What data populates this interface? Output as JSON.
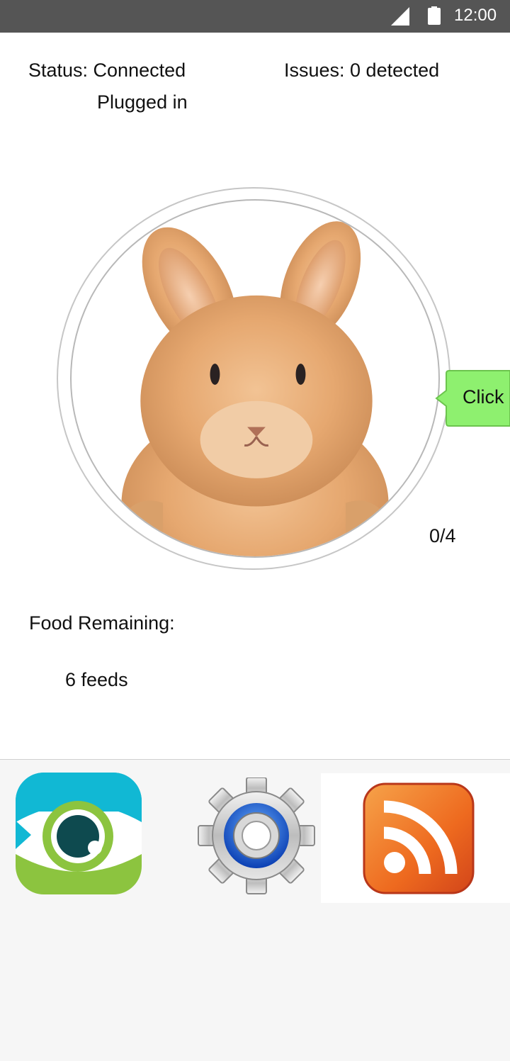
{
  "status_bar": {
    "time": "12:00",
    "signal_icon": "signal-icon",
    "battery_icon": "battery-icon"
  },
  "device": {
    "status": "Status: Connected",
    "power": "Plugged in",
    "issues": "Issues: 0 detected"
  },
  "pet": {
    "image_icon": "rabbit-photo",
    "callout_label": "Click",
    "counter": "0/4"
  },
  "food": {
    "label": "Food Remaining:",
    "value": "6 feeds"
  },
  "bottom_nav": {
    "items": [
      {
        "icon": "eye-icon",
        "selected": false
      },
      {
        "icon": "gear-icon",
        "selected": false
      },
      {
        "icon": "rss-icon",
        "selected": true
      }
    ]
  },
  "colors": {
    "status_bar": "#555555",
    "callout": "#8ef06f",
    "eye_teal": "#11b8d4",
    "eye_green": "#8cc43f",
    "rss_orange": "#ee6a1f",
    "bottom_bar": "#f6f6f6"
  }
}
